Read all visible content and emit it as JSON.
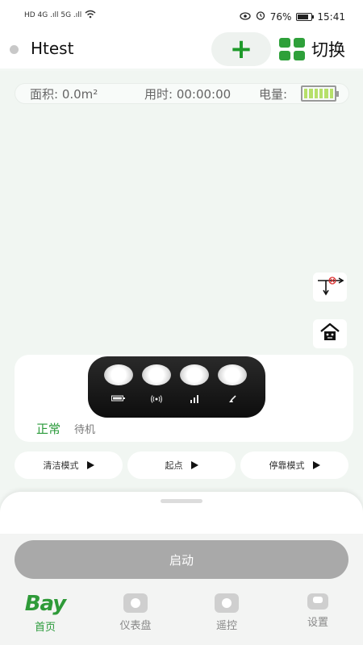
{
  "status_bar": {
    "signal_left": "HD 4G .ıll 5G .ıll",
    "battery_percent": "76%",
    "time": "15:41"
  },
  "header": {
    "device_name": "Htest",
    "add_symbol": "+",
    "switch_label": "切换"
  },
  "stats": {
    "area_label": "面积: 0.0m²",
    "time_label": "用时: 00:00:00",
    "battery_label": "电量:",
    "battery_level_fraction": 1.0
  },
  "indicator": {
    "icons": [
      "battery-icon",
      "signal-wave-icon",
      "signal-bars-icon",
      "brush-icon"
    ]
  },
  "status": {
    "state": "正常",
    "mode": "待机"
  },
  "modes": [
    {
      "label": "清洁模式"
    },
    {
      "label": "起点"
    },
    {
      "label": "停靠模式"
    }
  ],
  "start_button": {
    "label": "启动"
  },
  "tabs": [
    {
      "label": "首页",
      "logo": "Bay",
      "active": true
    },
    {
      "label": "仪表盘",
      "active": false
    },
    {
      "label": "遥控",
      "active": false
    },
    {
      "label": "设置",
      "active": false
    }
  ],
  "colors": {
    "accent": "#2e9a38",
    "start_button": "#a9a9a9"
  }
}
